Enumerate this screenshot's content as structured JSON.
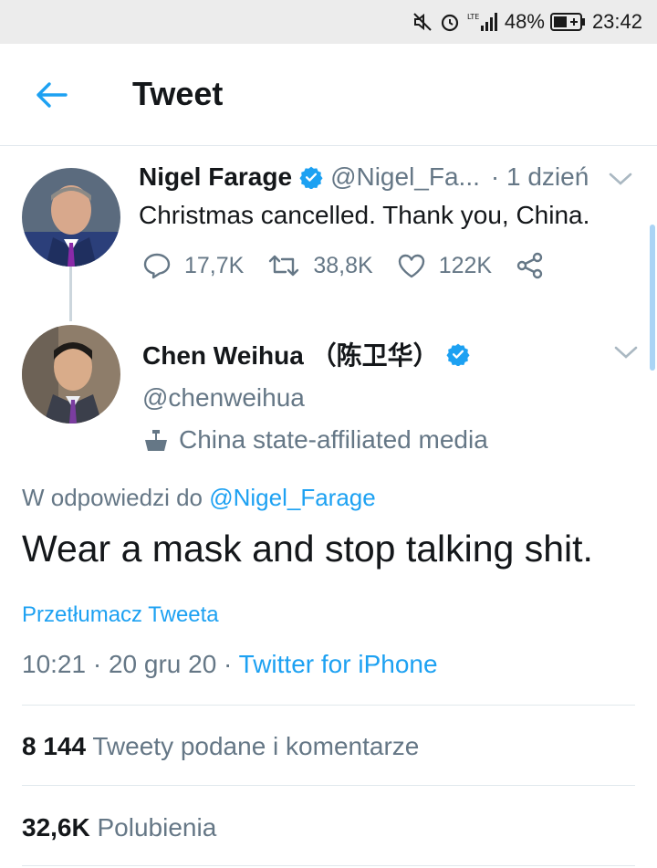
{
  "status_bar": {
    "battery": "48%",
    "time": "23:42",
    "network": "LTE"
  },
  "header": {
    "title": "Tweet"
  },
  "parent_tweet": {
    "name": "Nigel Farage",
    "handle": "@Nigel_Fa...",
    "time": "· 1 dzień",
    "text": "Christmas cancelled. Thank you, China.",
    "replies": "17,7K",
    "retweets": "38,8K",
    "likes": "122K"
  },
  "reply_author": {
    "name": "Chen Weihua （陈卫华）",
    "handle": "@chenweihua",
    "label": "China state-affiliated media"
  },
  "reply_context": {
    "prefix": "W odpowiedzi do ",
    "mention": "@Nigel_Farage"
  },
  "main_tweet": {
    "text": "Wear a mask and stop talking shit.",
    "translate": "Przetłumacz Tweeta",
    "timestamp": "10:21 · 20 gru 20 · ",
    "source": "Twitter for iPhone"
  },
  "stats": {
    "retweets_count": "8 144",
    "retweets_label": "Tweety podane i komentarze",
    "likes_count": "32,6K",
    "likes_label": "Polubienia"
  },
  "colors": {
    "accent": "#1da1f2",
    "secondary_text": "#657786",
    "status_bar": "#ececec"
  }
}
